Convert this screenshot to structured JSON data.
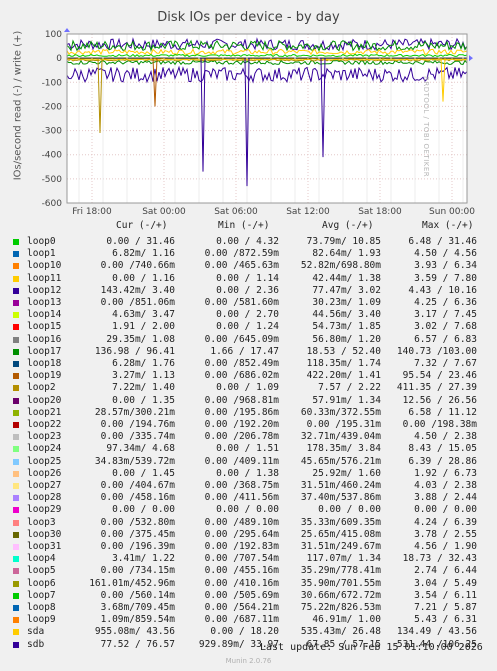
{
  "chart_data": {
    "type": "line",
    "title": "Disk IOs per device - by day",
    "ylabel": "IOs/second read (-) / write (+)",
    "side_label": "RRDTOOL / TOBI OETIKER",
    "ylim": [
      -600,
      100
    ],
    "yticks": [
      100,
      0,
      -100,
      -200,
      -300,
      -400,
      -500,
      -600
    ],
    "xticks": [
      "Fri 18:00",
      "Sat 00:00",
      "Sat 06:00",
      "Sat 12:00",
      "Sat 18:00",
      "Sun 00:00"
    ],
    "annotations": [
      {
        "series": "loop2",
        "x": "Fri 20:00",
        "y": -310
      },
      {
        "series": "loop19",
        "x": "Sat 00:00",
        "y": -200
      },
      {
        "series": "loop12",
        "x": "Sat 06:00",
        "y": -530
      },
      {
        "series": "loop12",
        "x": "Sat 05:00",
        "y": -470
      },
      {
        "series": "sda",
        "x": "Sun 00:00",
        "y": -180
      },
      {
        "series": "sdb",
        "x": "Sat 12:00",
        "y": -410
      }
    ],
    "series": [
      {
        "name": "loop0",
        "color": "#00cc00",
        "cur": "0.00 / 31.46",
        "min": "0.00 / 4.32",
        "avg": "73.79m/ 10.85",
        "max": "6.48 / 31.46"
      },
      {
        "name": "loop1",
        "color": "#0066b3",
        "cur": "6.82m/ 1.16",
        "min": "0.00 /872.59m",
        "avg": "82.64m/ 1.93",
        "max": "4.50 / 4.56"
      },
      {
        "name": "loop10",
        "color": "#ff8000",
        "cur": "0.00 /740.66m",
        "min": "0.00 /465.63m",
        "avg": "52.82m/698.80m",
        "max": "3.93 / 6.34"
      },
      {
        "name": "loop11",
        "color": "#ffcc00",
        "cur": "0.00 / 1.16",
        "min": "0.00 / 1.14",
        "avg": "42.44m/ 1.38",
        "max": "3.59 / 7.80"
      },
      {
        "name": "loop12",
        "color": "#330099",
        "cur": "143.42m/ 3.40",
        "min": "0.00 / 2.36",
        "avg": "77.47m/ 3.02",
        "max": "4.43 / 10.16"
      },
      {
        "name": "loop13",
        "color": "#990099",
        "cur": "0.00 /851.06m",
        "min": "0.00 /581.60m",
        "avg": "30.23m/ 1.09",
        "max": "4.25 / 6.36"
      },
      {
        "name": "loop14",
        "color": "#ccff00",
        "cur": "4.63m/ 3.47",
        "min": "0.00 / 2.70",
        "avg": "44.56m/ 3.40",
        "max": "3.17 / 7.45"
      },
      {
        "name": "loop15",
        "color": "#ff0000",
        "cur": "1.91 / 2.00",
        "min": "0.00 / 1.24",
        "avg": "54.73m/ 1.85",
        "max": "3.02 / 7.68"
      },
      {
        "name": "loop16",
        "color": "#808080",
        "cur": "29.35m/ 1.08",
        "min": "0.00 /645.09m",
        "avg": "56.80m/ 1.20",
        "max": "6.57 / 6.83"
      },
      {
        "name": "loop17",
        "color": "#008f00",
        "cur": "136.98 / 96.41",
        "min": "1.66 / 17.47",
        "avg": "18.53 / 52.40",
        "max": "140.73 /103.00"
      },
      {
        "name": "loop18",
        "color": "#00487d",
        "cur": "6.28m/ 1.76",
        "min": "0.00 /852.49m",
        "avg": "118.35m/ 1.74",
        "max": "7.32 / 7.67"
      },
      {
        "name": "loop19",
        "color": "#b35a00",
        "cur": "3.27m/ 1.13",
        "min": "0.00 /686.02m",
        "avg": "422.20m/ 1.41",
        "max": "95.54 / 23.46"
      },
      {
        "name": "loop2",
        "color": "#b38f00",
        "cur": "7.22m/ 1.40",
        "min": "0.00 / 1.09",
        "avg": "7.57 / 2.22",
        "max": "411.35 / 27.39"
      },
      {
        "name": "loop20",
        "color": "#6b006b",
        "cur": "0.00 / 1.35",
        "min": "0.00 /968.81m",
        "avg": "57.91m/ 1.34",
        "max": "12.56 / 26.56"
      },
      {
        "name": "loop21",
        "color": "#8fb300",
        "cur": "28.57m/300.21m",
        "min": "0.00 /195.86m",
        "avg": "60.33m/372.55m",
        "max": "6.58 / 11.12"
      },
      {
        "name": "loop22",
        "color": "#b30000",
        "cur": "0.00 /194.76m",
        "min": "0.00 /192.20m",
        "avg": "0.00 /195.31m",
        "max": "0.00 /198.38m"
      },
      {
        "name": "loop23",
        "color": "#bebebe",
        "cur": "0.00 /335.74m",
        "min": "0.00 /206.78m",
        "avg": "32.71m/439.04m",
        "max": "4.50 / 2.38"
      },
      {
        "name": "loop24",
        "color": "#80ff80",
        "cur": "97.34m/ 4.68",
        "min": "0.00 / 1.51",
        "avg": "178.35m/ 3.84",
        "max": "8.43 / 15.05"
      },
      {
        "name": "loop25",
        "color": "#80c9ff",
        "cur": "34.83m/539.72m",
        "min": "0.00 /409.11m",
        "avg": "45.65m/576.21m",
        "max": "6.39 / 28.86"
      },
      {
        "name": "loop26",
        "color": "#ffc080",
        "cur": "0.00 / 1.45",
        "min": "0.00 / 1.38",
        "avg": "25.92m/ 1.60",
        "max": "1.92 / 6.73"
      },
      {
        "name": "loop27",
        "color": "#ffe680",
        "cur": "0.00 /404.67m",
        "min": "0.00 /368.75m",
        "avg": "31.51m/460.24m",
        "max": "4.03 / 2.38"
      },
      {
        "name": "loop28",
        "color": "#aa80ff",
        "cur": "0.00 /458.16m",
        "min": "0.00 /411.56m",
        "avg": "37.40m/537.86m",
        "max": "3.88 / 2.44"
      },
      {
        "name": "loop29",
        "color": "#ee00cc",
        "cur": "0.00 / 0.00",
        "min": "0.00 / 0.00",
        "avg": "0.00 / 0.00",
        "max": "0.00 / 0.00"
      },
      {
        "name": "loop3",
        "color": "#ff8080",
        "cur": "0.00 /532.80m",
        "min": "0.00 /489.10m",
        "avg": "35.33m/609.35m",
        "max": "4.24 / 6.39"
      },
      {
        "name": "loop30",
        "color": "#666600",
        "cur": "0.00 /375.45m",
        "min": "0.00 /295.64m",
        "avg": "25.65m/415.08m",
        "max": "3.78 / 2.55"
      },
      {
        "name": "loop31",
        "color": "#ffbfff",
        "cur": "0.00 /196.39m",
        "min": "0.00 /192.83m",
        "avg": "31.51m/249.67m",
        "max": "4.56 / 1.90"
      },
      {
        "name": "loop4",
        "color": "#00ffcc",
        "cur": "3.41m/ 1.22",
        "min": "0.00 /707.54m",
        "avg": "117.07m/ 1.34",
        "max": "18.73 / 32.43"
      },
      {
        "name": "loop5",
        "color": "#cc6699",
        "cur": "0.00 /734.15m",
        "min": "0.00 /455.16m",
        "avg": "35.29m/778.41m",
        "max": "2.74 / 6.44"
      },
      {
        "name": "loop6",
        "color": "#999900",
        "cur": "161.01m/452.96m",
        "min": "0.00 /410.16m",
        "avg": "35.90m/701.55m",
        "max": "3.04 / 5.49"
      },
      {
        "name": "loop7",
        "color": "#00cc00",
        "cur": "0.00 /560.14m",
        "min": "0.00 /505.69m",
        "avg": "30.66m/672.72m",
        "max": "3.54 / 6.11"
      },
      {
        "name": "loop8",
        "color": "#0066b3",
        "cur": "3.68m/709.45m",
        "min": "0.00 /564.21m",
        "avg": "75.22m/826.53m",
        "max": "7.21 / 5.87"
      },
      {
        "name": "loop9",
        "color": "#ff8000",
        "cur": "1.09m/859.54m",
        "min": "0.00 /687.11m",
        "avg": "46.91m/ 1.00",
        "max": "5.43 / 6.31"
      },
      {
        "name": "sda",
        "color": "#ffcc00",
        "cur": "955.08m/ 43.56",
        "min": "0.00 / 18.20",
        "avg": "535.43m/ 26.48",
        "max": "134.49 / 43.56"
      },
      {
        "name": "sdb",
        "color": "#330099",
        "cur": "77.52 / 76.57",
        "min": "929.89m/ 33.97",
        "avg": "67.85 / 57.15",
        "max": "531.44 /106.25"
      }
    ]
  },
  "legend_header": {
    "cur": "Cur (-/+)",
    "min": "Min (-/+)",
    "avg": "Avg (-/+)",
    "max": "Max (-/+)"
  },
  "footer": {
    "last_update": "Last update: Sun Feb 15 01:10:00 2026",
    "munin": "Munin 2.0.76"
  }
}
